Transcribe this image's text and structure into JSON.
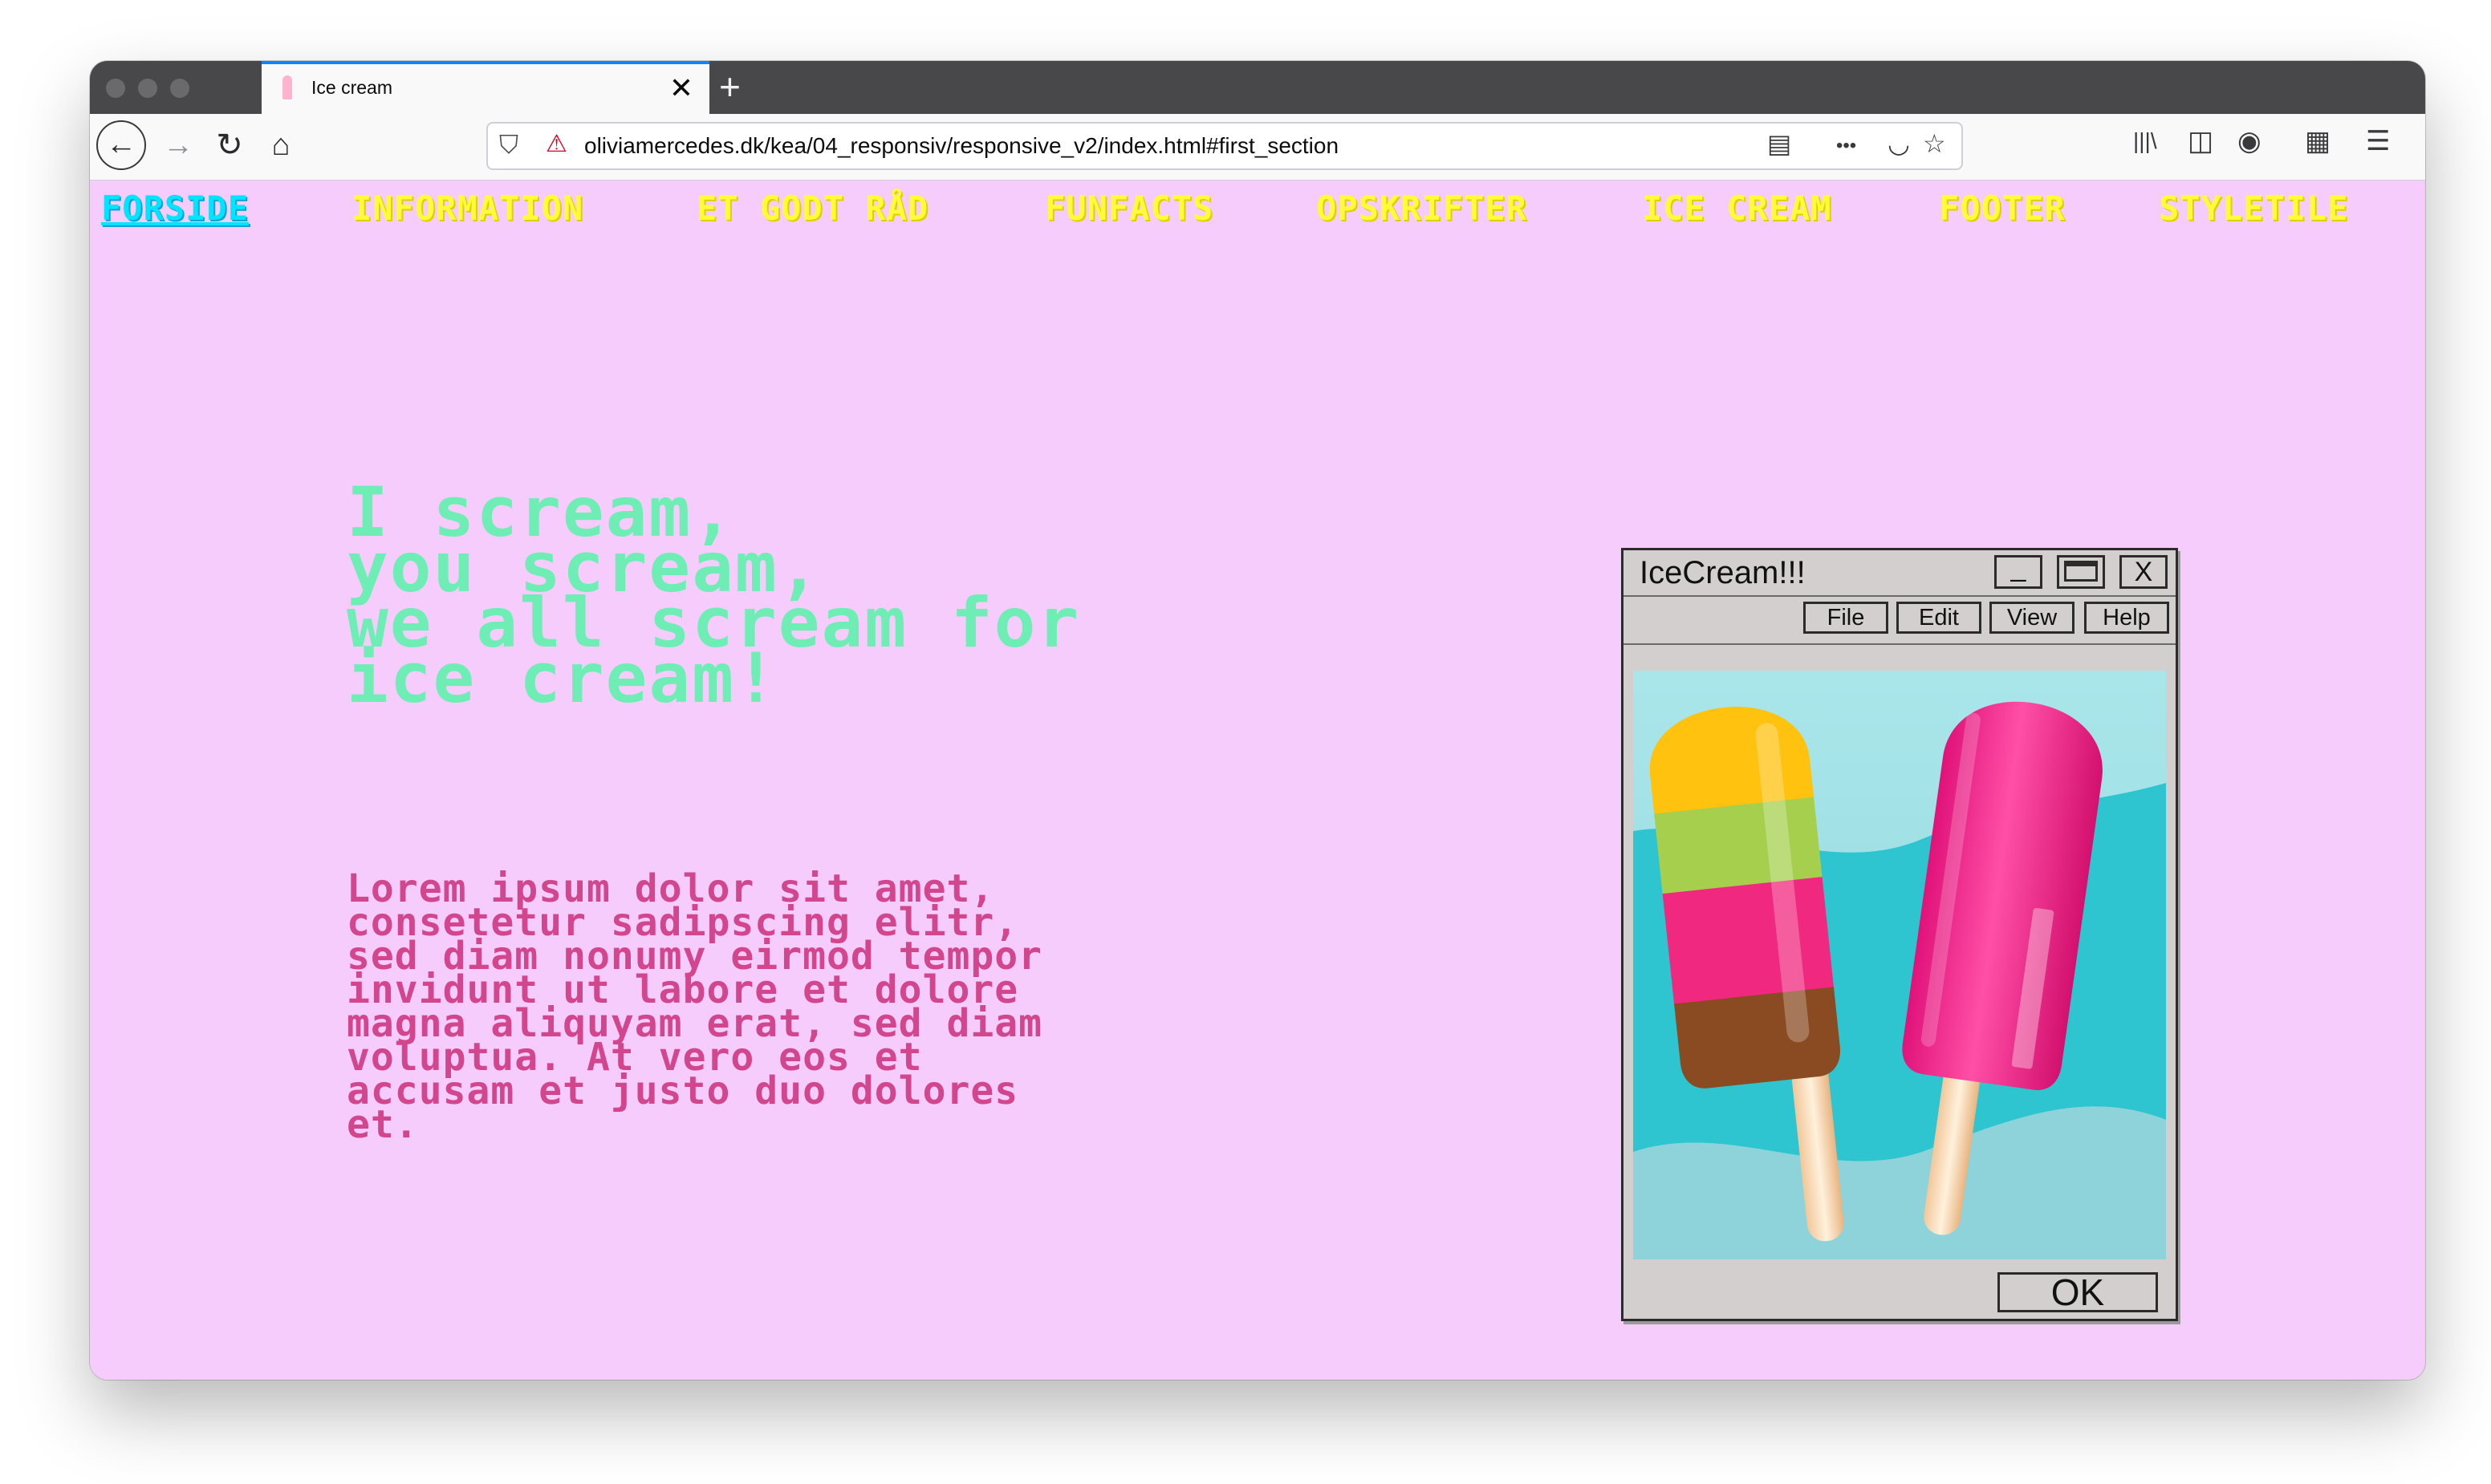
{
  "browser": {
    "tab_title": "Ice cream",
    "tab_close": "✕",
    "new_tab": "+",
    "url": "oliviamercedes.dk/kea/04_responsiv/responsive_v2/index.html#first_section",
    "icons": {
      "back": "←",
      "forward": "→",
      "reload": "↻",
      "home": "⌂",
      "shield": "⛉",
      "lock": "⚠",
      "reader": "▤",
      "more": "•••",
      "pocket": "◡",
      "star": "☆",
      "library": "|||\\",
      "sidebar": "◫",
      "account": "◉",
      "extensions": "▦",
      "menu": "☰"
    }
  },
  "site_nav": {
    "items": [
      {
        "label": "FORSIDE",
        "active": true
      },
      {
        "label": "INFORMATION"
      },
      {
        "label": "ET GODT RÅD"
      },
      {
        "label": "FUNFACTS"
      },
      {
        "label": "OPSKRIFTER"
      },
      {
        "label": "ICE CREAM"
      },
      {
        "label": "FOOTER"
      },
      {
        "label": "STYLETILE"
      }
    ]
  },
  "hero": {
    "title": "I scream,\nyou scream,\nwe all scream for\nice cream!",
    "body": "Lorem ipsum dolor sit amet,\nconsetetur sadipscing elitr,\nsed diam nonumy eirmod tempor\ninvidunt ut labore et dolore\nmagna aliquyam erat, sed diam\nvoluptua. At vero eos et\naccusam et justo duo dolores\net."
  },
  "dialog": {
    "title": "IceCream!!!",
    "minimize": "_",
    "maximize": "",
    "close": "X",
    "menus": [
      "File",
      "Edit",
      "View",
      "Help"
    ],
    "ok_label": "OK"
  },
  "colors": {
    "page_bg": "#f5ccfb",
    "nav_text": "#fffb3a",
    "nav_active": "#00e5ff",
    "title": "#6eeeb4",
    "body": "#d2468d",
    "dialog_bg": "#d3cfcf"
  }
}
